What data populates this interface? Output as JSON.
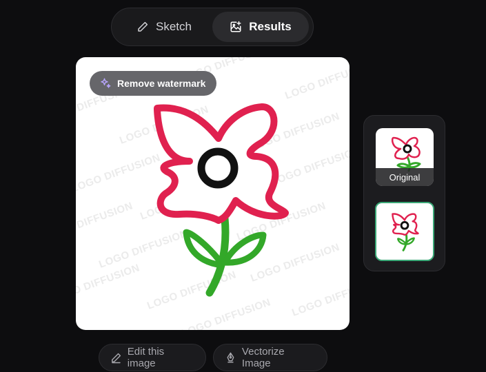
{
  "tabs": {
    "sketch_label": "Sketch",
    "results_label": "Results",
    "active": "Results"
  },
  "canvas": {
    "remove_watermark_label": "Remove watermark",
    "watermark_text": "LOGO DIFFUSION"
  },
  "thumbnails": {
    "original_label": "Original",
    "selected": 1
  },
  "actions": {
    "edit_label": "Edit this image",
    "vectorize_label": "Vectorize Image"
  },
  "colors": {
    "background": "#0d0d0f",
    "petal": "#e0214f",
    "center": "#111111",
    "stem": "#33a829",
    "selected_border": "#3aa776",
    "sparkle": "#b9a6ff"
  },
  "icons": {
    "sketch_tab": "pencil-icon",
    "results_tab": "image-sparkle-icon",
    "remove_watermark": "sparkles-icon",
    "edit": "pencil-icon",
    "vectorize": "pen-nib-icon"
  }
}
